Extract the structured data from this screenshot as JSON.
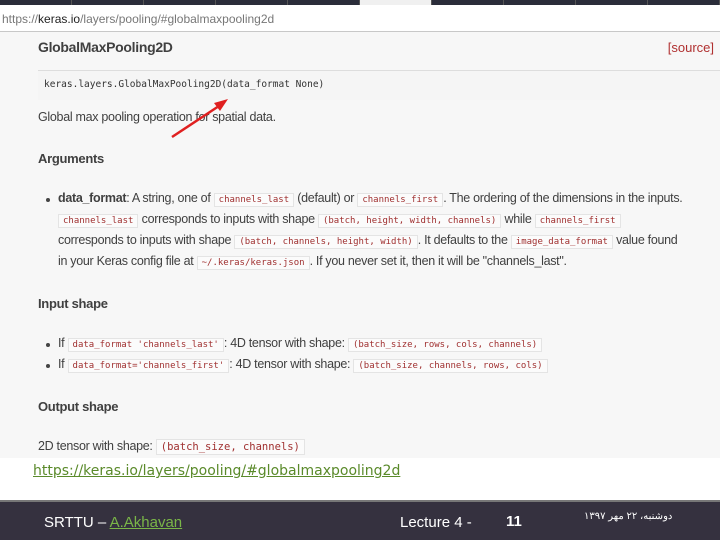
{
  "browser": {
    "url_prefix": "https://",
    "url_host": "keras.io",
    "url_path": "/layers/pooling/#globalmaxpooling2d"
  },
  "doc": {
    "title": "GlobalMaxPooling2D",
    "source_link": "[source]",
    "signature": "keras.layers.GlobalMaxPooling2D(data_format None)",
    "description": "Global max pooling operation for spatial data.",
    "arguments_heading": "Arguments",
    "arg": {
      "name": "data_format",
      "t1": ": A string, one of ",
      "c1": "channels_last",
      "t2": " (default) or ",
      "c2": "channels_first",
      "t3": ". The ordering of the dimensions in the inputs.",
      "c3": "channels_last",
      "t4": " corresponds to inputs with shape ",
      "c4": "(batch, height, width, channels)",
      "t5": " while ",
      "c5": "channels_first",
      "t6": "corresponds to inputs with shape ",
      "c6": "(batch, channels, height, width)",
      "t7": ". It defaults to the ",
      "c7": "image_data_format",
      "t8": " value found",
      "t9": "in your Keras config file at ",
      "c8": "~/.keras/keras.json",
      "t10": ". If you never set it, then it will be \"channels_last\"."
    },
    "input_heading": "Input shape",
    "inputs": [
      {
        "if": "If ",
        "code": "data_format 'channels_last'",
        "mid": ": 4D tensor with shape: ",
        "shape": "(batch_size, rows, cols, channels)"
      },
      {
        "if": "If ",
        "code": "data_format='channels_first'",
        "mid": ": 4D tensor with shape: ",
        "shape": "(batch_size, channels, rows, cols)"
      }
    ],
    "output_heading": "Output shape",
    "output_text": "2D tensor with shape: ",
    "output_shape": "(batch_size, channels)"
  },
  "slide": {
    "link": "https://keras.io/layers/pooling/#globalmaxpooling2d",
    "footer_org": "SRTTU – ",
    "footer_author": "A.Akhavan",
    "footer_lecture": "Lecture 4 -",
    "page_number": "11",
    "date": "دوشنبه، ۲۲ مهر ۱۳۹۷"
  },
  "colors": {
    "annotation_arrow": "#e02020",
    "footer_bg": "#35313f",
    "link": "#5a8a2a"
  }
}
